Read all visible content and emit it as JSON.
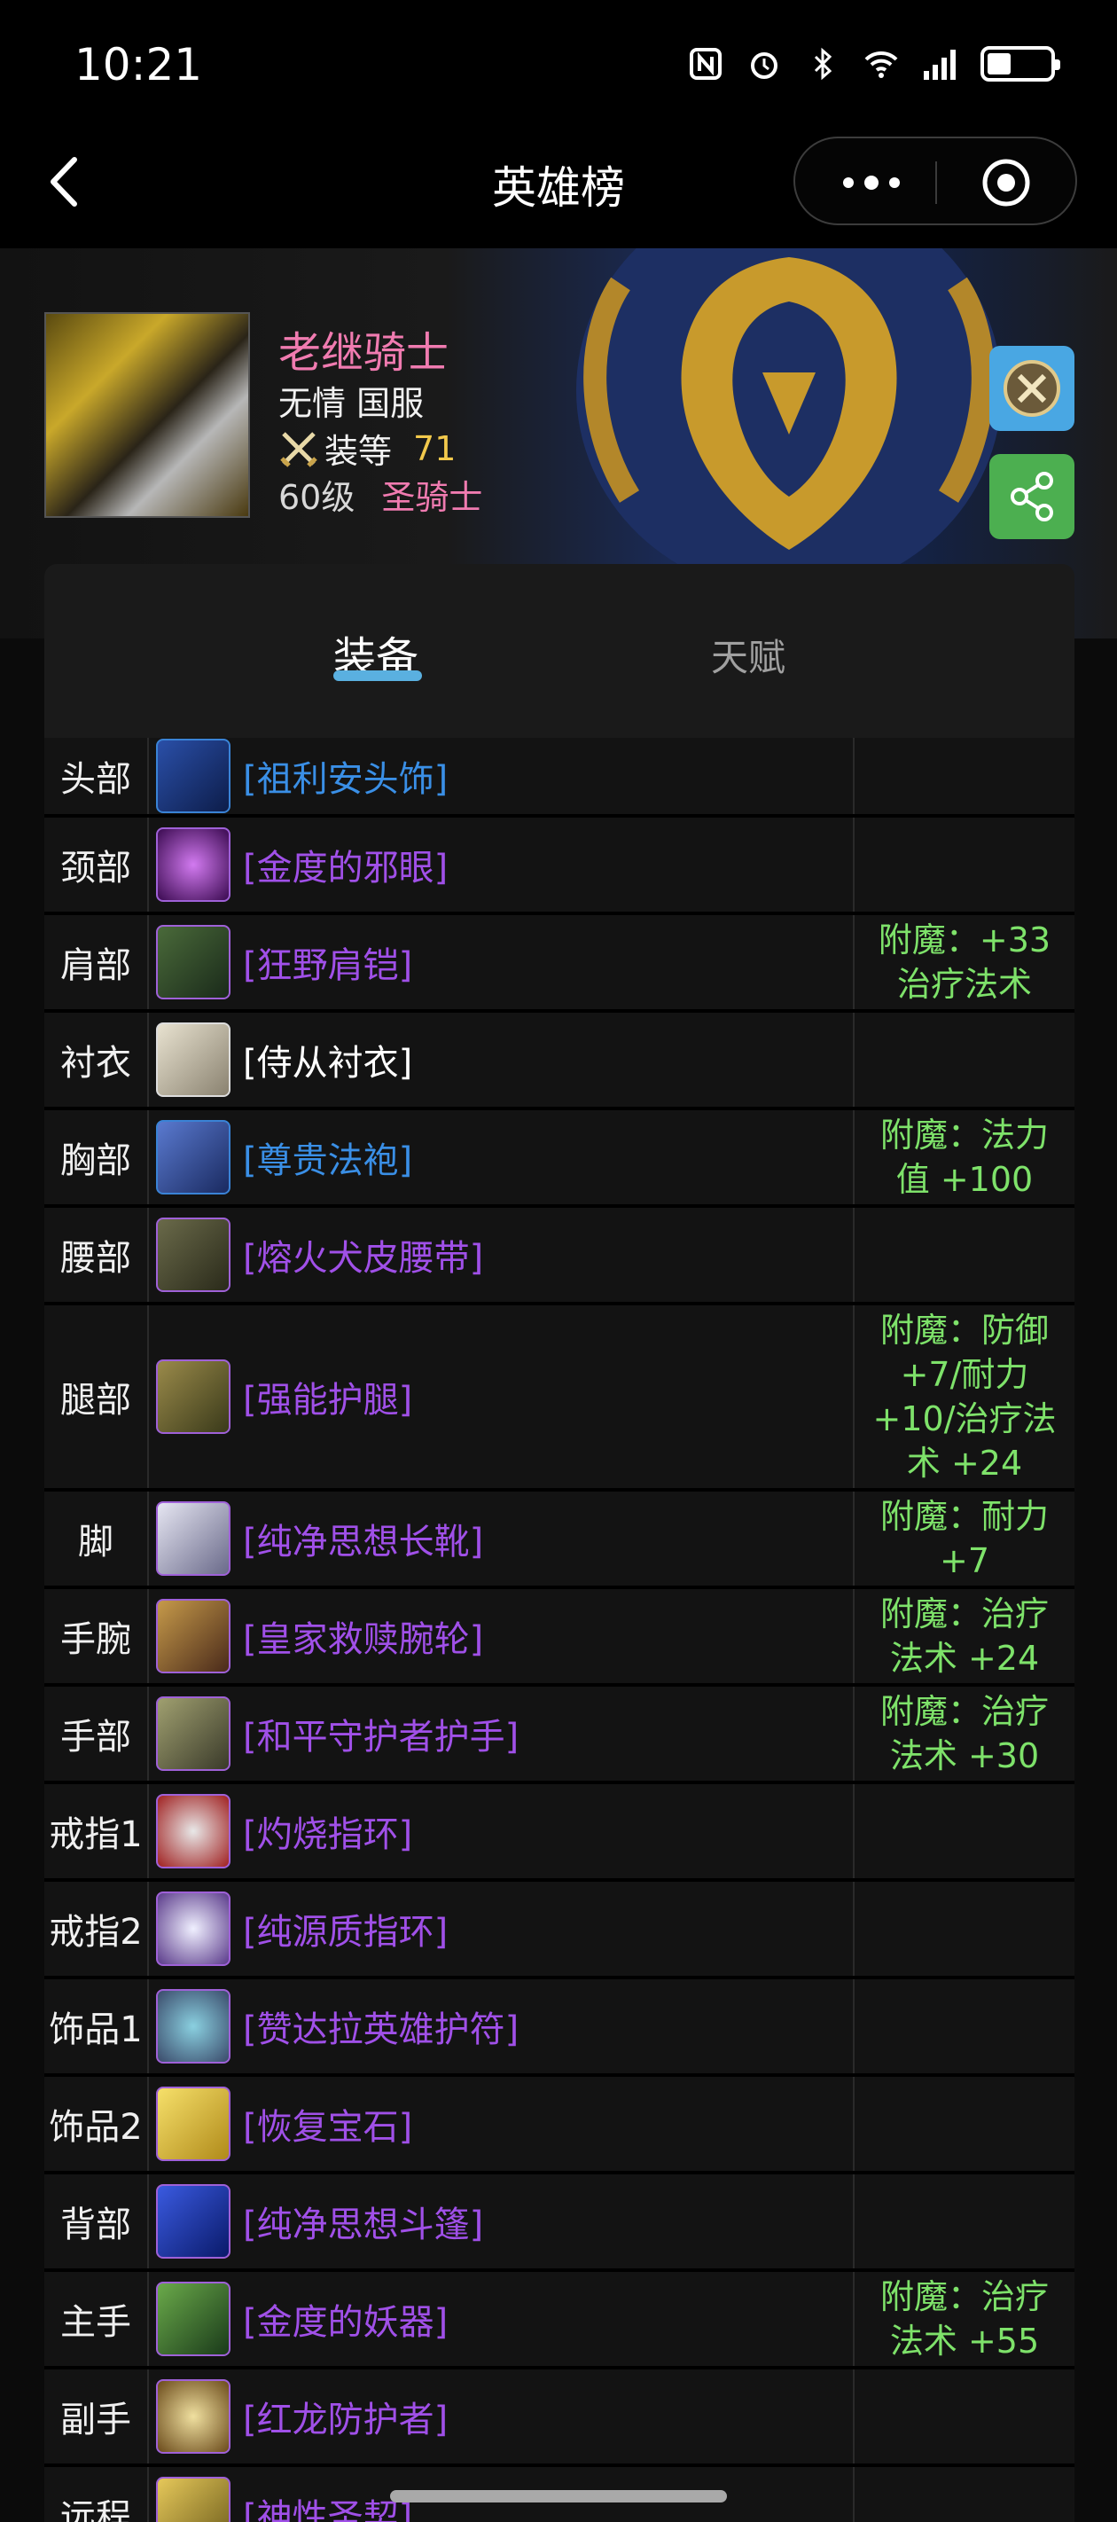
{
  "status_bar": {
    "time": "10:21"
  },
  "nav": {
    "title": "英雄榜"
  },
  "hero": {
    "name": "老继骑士",
    "realm": "无情 国服",
    "ilvl_label": "装等",
    "ilvl_value": "71",
    "level": "60级",
    "class": "圣骑士"
  },
  "tabs": [
    {
      "label": "装备"
    },
    {
      "label": "天赋"
    }
  ],
  "colors": {
    "epic": "#a050e8",
    "rare": "#3a8fe6",
    "enchant": "#7ee26a",
    "name_pink": "#f07bb0",
    "ilvl_gold": "#f2c94c"
  },
  "equipment": [
    {
      "slot": "头部",
      "item": "[祖利安头饰]",
      "quality": "rare",
      "enchant": ""
    },
    {
      "slot": "颈部",
      "item": "[金度的邪眼]",
      "quality": "epic",
      "enchant": ""
    },
    {
      "slot": "肩部",
      "item": "[狂野肩铠]",
      "quality": "epic",
      "enchant": "附魔：+33治疗法术"
    },
    {
      "slot": "衬衣",
      "item": "[侍从衬衣]",
      "quality": "common",
      "enchant": ""
    },
    {
      "slot": "胸部",
      "item": "[尊贵法袍]",
      "quality": "rare",
      "enchant": "附魔：法力值 +100"
    },
    {
      "slot": "腰部",
      "item": "[熔火犬皮腰带]",
      "quality": "epic",
      "enchant": ""
    },
    {
      "slot": "腿部",
      "item": "[强能护腿]",
      "quality": "epic",
      "enchant": "附魔：防御+7/耐力+10/治疗法术 +24"
    },
    {
      "slot": "脚",
      "item": "[纯净思想长靴]",
      "quality": "epic",
      "enchant": "附魔：耐力+7"
    },
    {
      "slot": "手腕",
      "item": "[皇家救赎腕轮]",
      "quality": "epic",
      "enchant": "附魔：治疗法术 +24"
    },
    {
      "slot": "手部",
      "item": "[和平守护者护手]",
      "quality": "epic",
      "enchant": "附魔：治疗法术 +30"
    },
    {
      "slot": "戒指1",
      "item": "[灼烧指环]",
      "quality": "epic",
      "enchant": ""
    },
    {
      "slot": "戒指2",
      "item": "[纯源质指环]",
      "quality": "epic",
      "enchant": ""
    },
    {
      "slot": "饰品1",
      "item": "[赞达拉英雄护符]",
      "quality": "epic",
      "enchant": ""
    },
    {
      "slot": "饰品2",
      "item": "[恢复宝石]",
      "quality": "epic",
      "enchant": ""
    },
    {
      "slot": "背部",
      "item": "[纯净思想斗篷]",
      "quality": "epic",
      "enchant": ""
    },
    {
      "slot": "主手",
      "item": "[金度的妖器]",
      "quality": "epic",
      "enchant": "附魔：治疗法术 +55"
    },
    {
      "slot": "副手",
      "item": "[红龙防护者]",
      "quality": "epic",
      "enchant": ""
    },
    {
      "slot": "远程",
      "item": "[神性圣契]",
      "quality": "epic",
      "enchant": ""
    }
  ]
}
